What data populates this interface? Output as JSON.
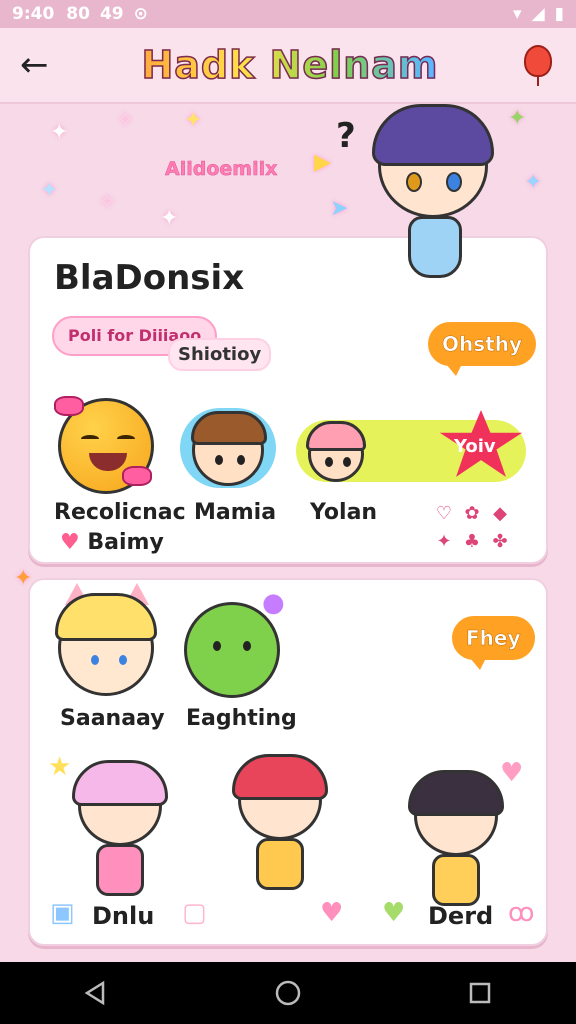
{
  "status_bar": {
    "time": "9:40",
    "indicators": [
      "80",
      "49"
    ],
    "icons": [
      "notification-icon",
      "wifi-icon",
      "signal-icon",
      "battery-icon"
    ]
  },
  "header": {
    "title": "Hadk Nelnam",
    "back_icon": "arrow-left-icon",
    "action_icon": "balloon-icon"
  },
  "hero": {
    "subtitle": "Aiidoemiix",
    "question_mark": "?"
  },
  "card1": {
    "title": "BlaDonsix",
    "cloud_tag": "Poli for Diiiaoo",
    "shadow_tag": "Shiotioy",
    "speech_label": "Ohsthy",
    "star_badge": "Yoiv",
    "characters": [
      {
        "label": "Recolicnac",
        "sublabel": "Baimy"
      },
      {
        "label": "Mamia"
      },
      {
        "label": "Yolan"
      }
    ],
    "mini_icons": [
      "♡",
      "✿",
      "◆",
      "✦",
      "♣",
      "✤"
    ]
  },
  "card2": {
    "speech_label": "Fhey",
    "characters_top": [
      {
        "label": "Saanaay"
      },
      {
        "label": "Eaghting"
      }
    ],
    "bottom_left_label": "Dnlu",
    "bottom_right_label": "Derd"
  },
  "colors": {
    "background": "#f7d9e8",
    "accent_pink": "#ff5fa6",
    "accent_orange": "#ffa123",
    "star_red": "#f0325a"
  },
  "nav": {
    "icons": [
      "back-triangle-icon",
      "home-circle-icon",
      "recents-square-icon"
    ]
  }
}
